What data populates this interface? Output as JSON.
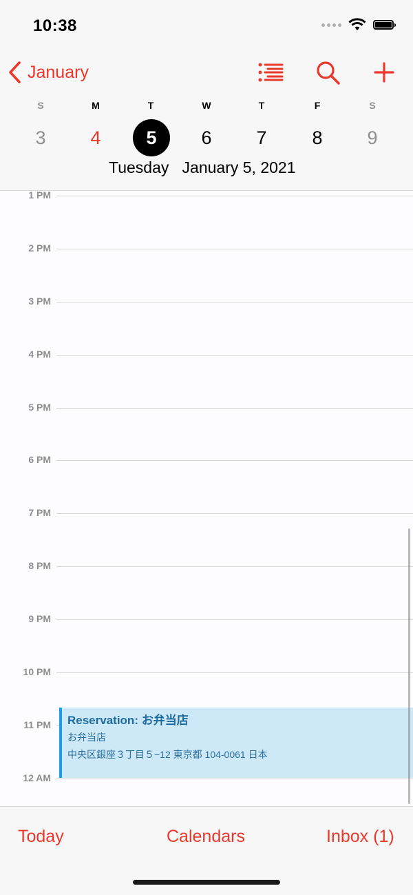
{
  "status_bar": {
    "time": "10:38"
  },
  "nav": {
    "back_label": "January"
  },
  "week": {
    "days": [
      "S",
      "M",
      "T",
      "W",
      "T",
      "F",
      "S"
    ],
    "dates": [
      "3",
      "4",
      "5",
      "6",
      "7",
      "8",
      "9"
    ],
    "weekday": "Tuesday",
    "date": "January 5, 2021"
  },
  "timeline": {
    "hours": [
      "1 PM",
      "2 PM",
      "3 PM",
      "4 PM",
      "5 PM",
      "6 PM",
      "7 PM",
      "8 PM",
      "9 PM",
      "10 PM",
      "11 PM",
      "12 AM"
    ]
  },
  "event": {
    "title": "Reservation: お弁当店",
    "location_name": "お弁当店",
    "address": "中央区銀座３丁目５−12 東京都 104-0061 日本"
  },
  "tabbar": {
    "today": "Today",
    "calendars": "Calendars",
    "inbox": "Inbox (1)"
  },
  "colors": {
    "accent": "#e8392c",
    "event_fill": "#cde8f7",
    "event_bar": "#1a9ee5"
  }
}
